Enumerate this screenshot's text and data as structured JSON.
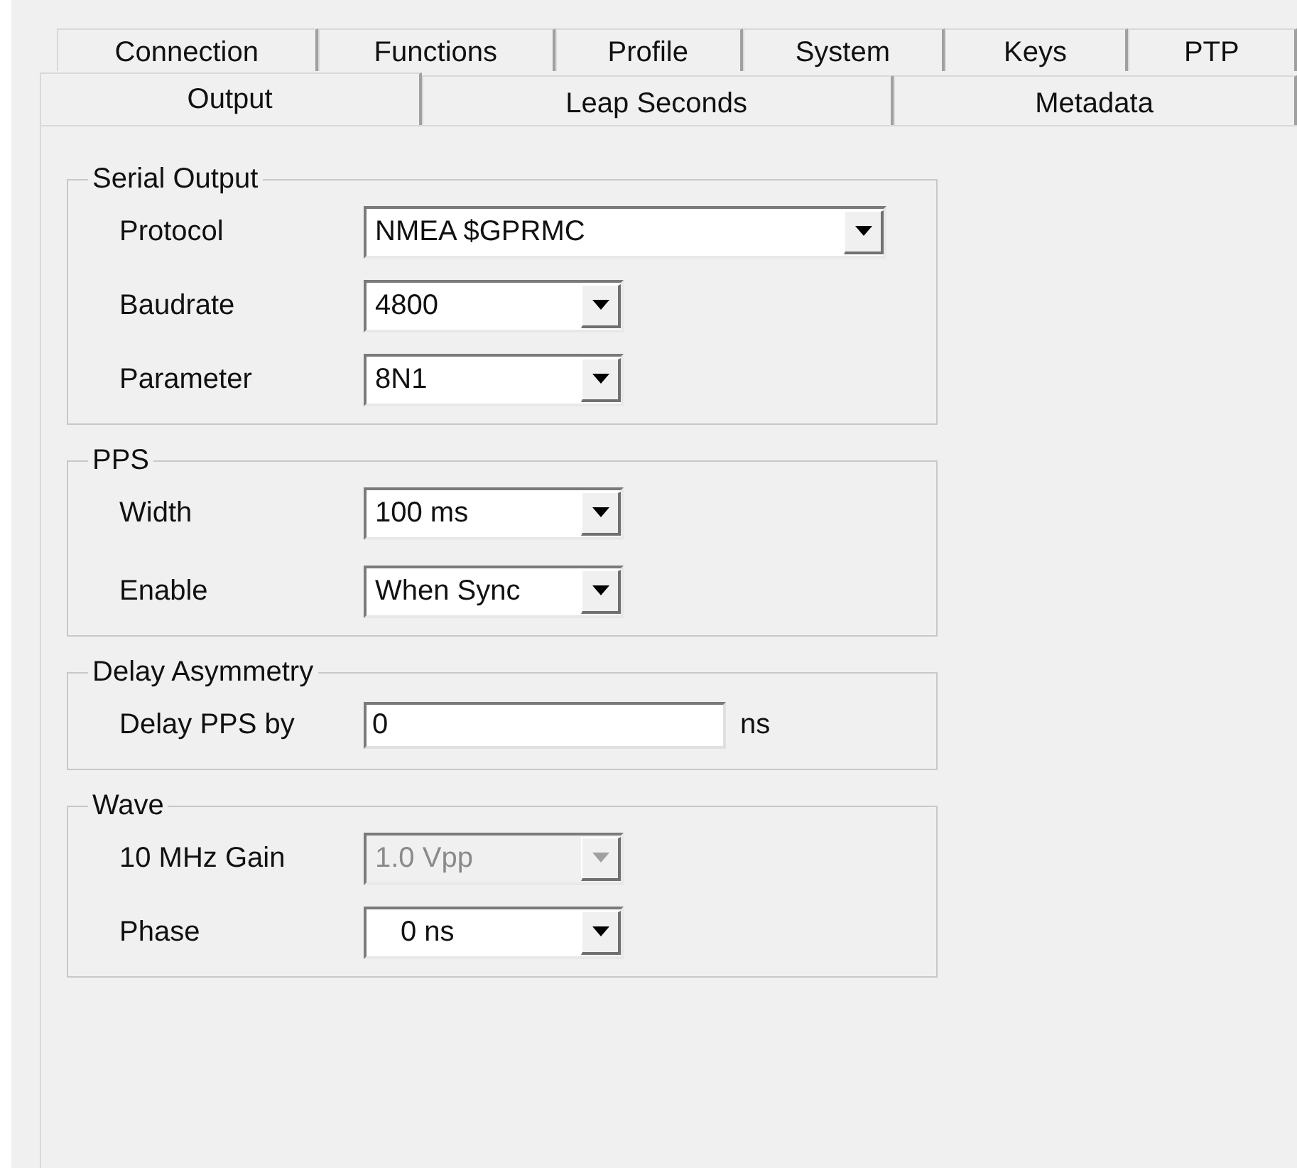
{
  "tab_rows": [
    [
      {
        "label": "Connection",
        "selected": false
      },
      {
        "label": "Functions",
        "selected": false
      },
      {
        "label": "Profile",
        "selected": false
      },
      {
        "label": "System",
        "selected": false
      },
      {
        "label": "Keys",
        "selected": false
      },
      {
        "label": "PTP",
        "selected": false
      }
    ],
    [
      {
        "label": "Output",
        "selected": true
      },
      {
        "label": "Leap Seconds",
        "selected": false
      },
      {
        "label": "Metadata",
        "selected": false
      }
    ]
  ],
  "groups": [
    {
      "title": "Serial Output",
      "rows": [
        {
          "label": "Protocol",
          "kind": "combo",
          "value": "NMEA $GPRMC",
          "disabled": false,
          "wide": true
        },
        {
          "label": "Baudrate",
          "kind": "combo",
          "value": "4800",
          "disabled": false
        },
        {
          "label": "Parameter",
          "kind": "combo",
          "value": "8N1",
          "disabled": false
        }
      ]
    },
    {
      "title": "PPS",
      "rows": [
        {
          "label": "Width",
          "kind": "combo",
          "value": "100 ms",
          "disabled": false
        },
        {
          "label": "Enable",
          "kind": "combo",
          "value": "When Sync",
          "disabled": false
        }
      ]
    },
    {
      "title": "Delay Asymmetry",
      "rows": [
        {
          "label": "Delay PPS by",
          "kind": "input",
          "value": "0",
          "unit": "ns"
        }
      ]
    },
    {
      "title": "Wave",
      "rows": [
        {
          "label": "10 MHz Gain",
          "kind": "combo",
          "value": "1.0 Vpp",
          "disabled": true
        },
        {
          "label": "Phase",
          "kind": "combo",
          "value": "0 ns",
          "disabled": false,
          "indent": true
        }
      ]
    }
  ]
}
